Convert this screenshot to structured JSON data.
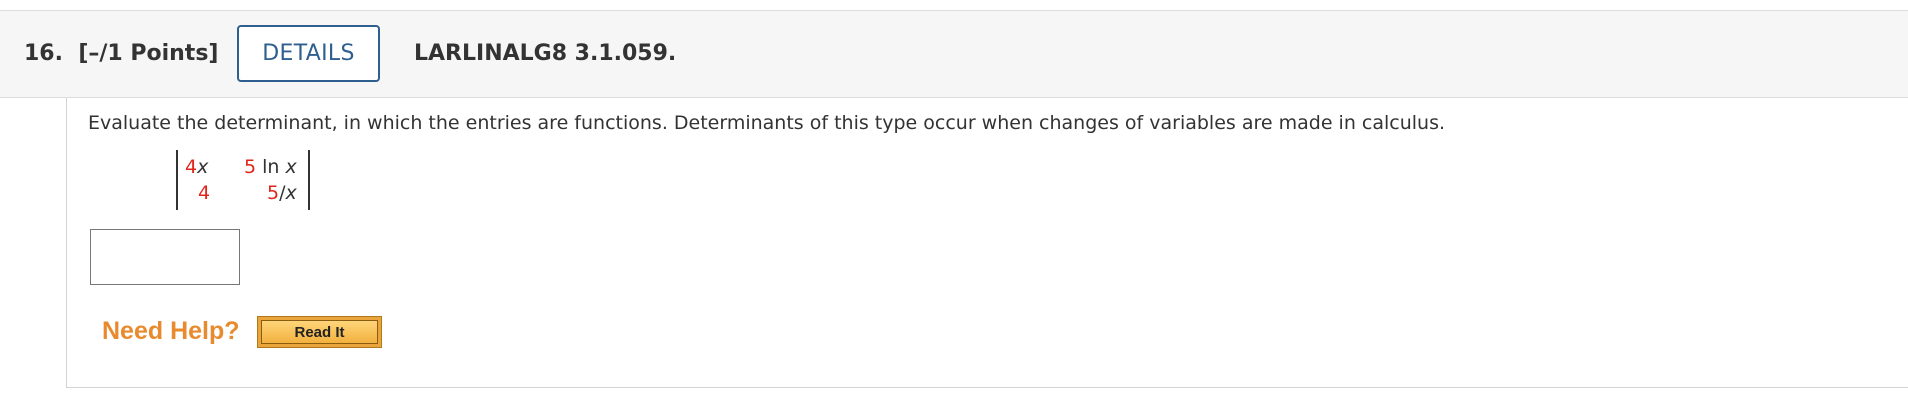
{
  "header": {
    "question_number": "16.",
    "points": "[–/1 Points]",
    "details_label": "DETAILS",
    "question_code": "LARLINALG8 3.1.059."
  },
  "question": {
    "prompt": "Evaluate the determinant, in which the entries are functions. Determinants of this type occur when changes of variables are made in calculus.",
    "matrix": {
      "r1c1_coef": "4",
      "r1c1_var": "x",
      "r1c2_coef": "5",
      "r1c2_fn": "ln",
      "r1c2_var": "x",
      "r2c1_coef": "4",
      "r2c2_coef": "5",
      "r2c2_suffix": "/",
      "r2c2_var": "x"
    },
    "answer": {
      "value": "",
      "placeholder": ""
    }
  },
  "help": {
    "label": "Need Help?",
    "read_it_label": "Read It"
  },
  "colors": {
    "accent_blue": "#2f5f8f",
    "coefficient_red": "#e0261b",
    "help_orange": "#e88b2e",
    "button_gold": "#e9a43c"
  }
}
